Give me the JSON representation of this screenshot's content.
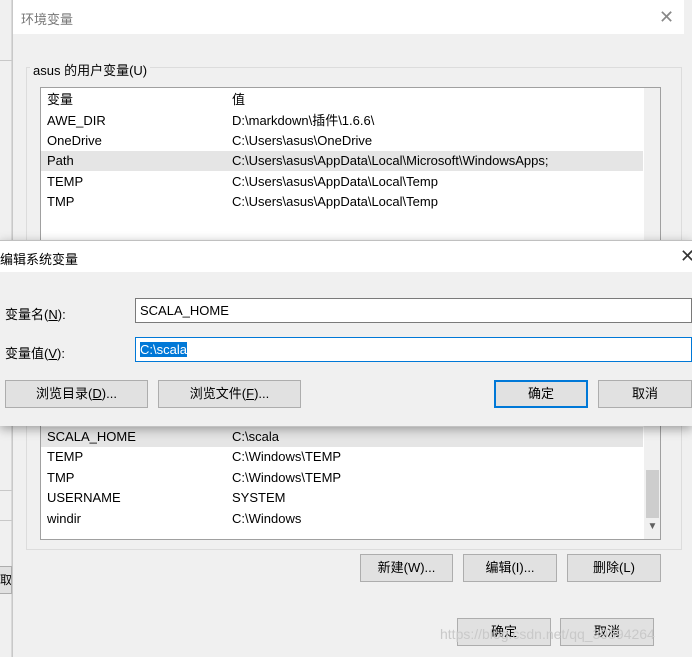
{
  "background": {
    "left_button_fragment": "取"
  },
  "env_window": {
    "title": "环境变量",
    "user_group_label": "asus 的用户变量(U)",
    "user_list": {
      "headers": [
        "变量",
        "值"
      ],
      "rows": [
        {
          "name": "AWE_DIR",
          "value": "D:\\markdown\\插件\\1.6.6\\"
        },
        {
          "name": "OneDrive",
          "value": "C:\\Users\\asus\\OneDrive"
        },
        {
          "name": "Path",
          "value": "C:\\Users\\asus\\AppData\\Local\\Microsoft\\WindowsApps;"
        },
        {
          "name": "TEMP",
          "value": "C:\\Users\\asus\\AppData\\Local\\Temp"
        },
        {
          "name": "TMP",
          "value": "C:\\Users\\asus\\AppData\\Local\\Temp"
        }
      ],
      "selected_row_index": 2
    },
    "system_list": {
      "rows": [
        {
          "name": "SCALA_HOME",
          "value": "C:\\scala"
        },
        {
          "name": "TEMP",
          "value": "C:\\Windows\\TEMP"
        },
        {
          "name": "TMP",
          "value": "C:\\Windows\\TEMP"
        },
        {
          "name": "USERNAME",
          "value": "SYSTEM"
        },
        {
          "name": "windir",
          "value": "C:\\Windows"
        }
      ],
      "selected_row_index": 0
    },
    "system_buttons": {
      "new": "新建(W)...",
      "edit": "编辑(I)...",
      "delete": "删除(L)"
    },
    "ok": "确定",
    "cancel": "取消"
  },
  "edit_dialog": {
    "title": "编辑系统变量",
    "name_label": "变量名(",
    "name_key": "N",
    "name_label_end": "):",
    "name_value": "SCALA_HOME",
    "value_label": "变量值(",
    "value_key": "V",
    "value_label_end": "):",
    "value_value": "C:\\scala",
    "browse_dir": {
      "text": "浏览目录(",
      "key": "D",
      "end": ")..."
    },
    "browse_file": {
      "text": "浏览文件(",
      "key": "F",
      "end": ")..."
    },
    "ok": "确定",
    "cancel": "取消"
  },
  "watermark": "https://blog.csdn.net/qq_39394264",
  "icons": {
    "close": "close-icon",
    "scroll_down": "chevron-down-icon"
  },
  "colors": {
    "accent": "#0078d7",
    "dialog_bg": "#f0f0f0",
    "selection_row": "#e5e5e5"
  }
}
